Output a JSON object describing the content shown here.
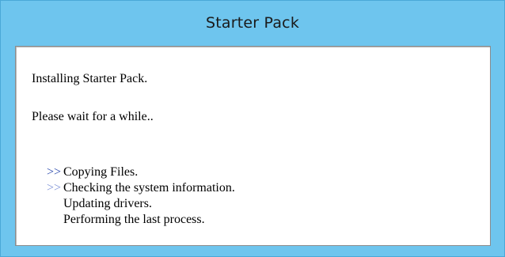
{
  "window": {
    "title": "Starter Pack"
  },
  "content": {
    "message_installing": "Installing Starter Pack.",
    "message_wait": "Please wait for a while..",
    "steps": [
      {
        "marker": ">>",
        "label": "Copying Files.",
        "state": "done"
      },
      {
        "marker": ">>",
        "label": "Checking the system information.",
        "state": "active"
      },
      {
        "marker": "",
        "label": "Updating drivers.",
        "state": "pending"
      },
      {
        "marker": "",
        "label": "Performing the last process.",
        "state": "pending"
      }
    ]
  },
  "colors": {
    "window_background": "#6ec5ee",
    "content_background": "#ffffff",
    "marker_done": "#1f3fa8",
    "marker_active": "#7a8fd6"
  }
}
